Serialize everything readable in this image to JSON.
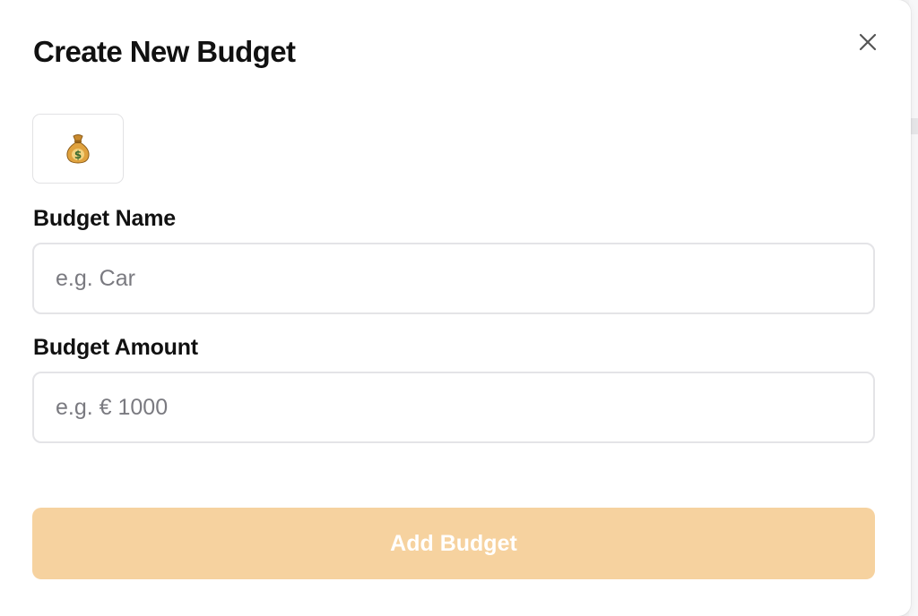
{
  "dialog": {
    "title": "Create New Budget",
    "close_icon": "close-icon",
    "emoji": "💰",
    "emoji_icon": "money-bag-icon"
  },
  "fields": {
    "name": {
      "label": "Budget Name",
      "value": "",
      "placeholder": "e.g. Car"
    },
    "amount": {
      "label": "Budget Amount",
      "value": "",
      "placeholder": "e.g. € 1000"
    }
  },
  "submit": {
    "label": "Add Budget",
    "state": "disabled"
  },
  "colors": {
    "submit_bg": "#f6d29f",
    "submit_text": "#ffffff",
    "input_border": "#e4e4e7",
    "title_text": "#111111",
    "placeholder_text": "#7a7a80"
  }
}
